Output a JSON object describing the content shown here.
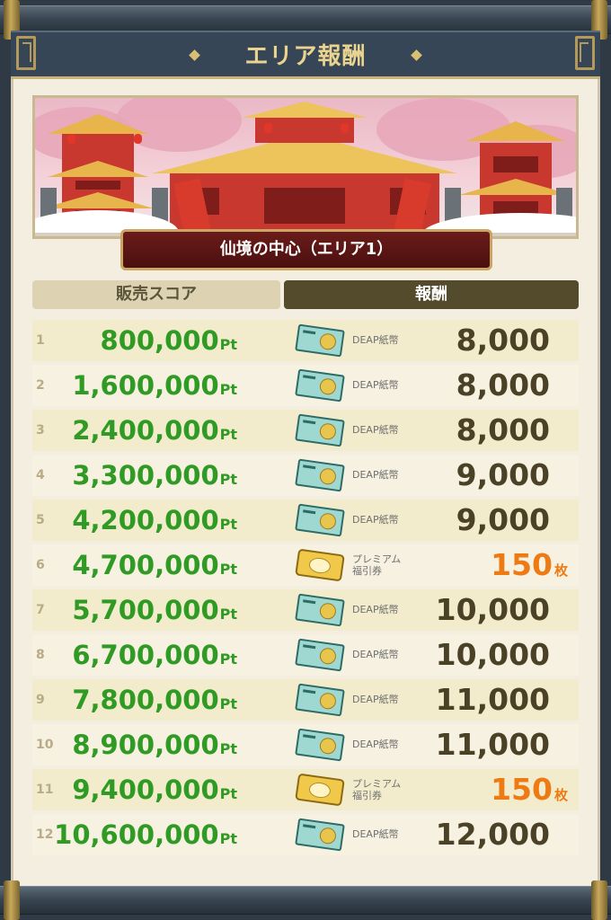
{
  "title": "エリア報酬",
  "area_name": "仙境の中心（エリア1）",
  "columns": {
    "score": "販売スコア",
    "reward": "報酬"
  },
  "score_unit": "Pt",
  "rows": [
    {
      "rank": "1",
      "score": "800,000",
      "item": "DEAP紙幣",
      "amount": "8,000",
      "unit": "",
      "ticket": "green"
    },
    {
      "rank": "2",
      "score": "1,600,000",
      "item": "DEAP紙幣",
      "amount": "8,000",
      "unit": "",
      "ticket": "green"
    },
    {
      "rank": "3",
      "score": "2,400,000",
      "item": "DEAP紙幣",
      "amount": "8,000",
      "unit": "",
      "ticket": "green"
    },
    {
      "rank": "4",
      "score": "3,300,000",
      "item": "DEAP紙幣",
      "amount": "9,000",
      "unit": "",
      "ticket": "green"
    },
    {
      "rank": "5",
      "score": "4,200,000",
      "item": "DEAP紙幣",
      "amount": "9,000",
      "unit": "",
      "ticket": "green"
    },
    {
      "rank": "6",
      "score": "4,700,000",
      "item": "プレミアム福引券",
      "amount": "150",
      "unit": "枚",
      "ticket": "gold"
    },
    {
      "rank": "7",
      "score": "5,700,000",
      "item": "DEAP紙幣",
      "amount": "10,000",
      "unit": "",
      "ticket": "green"
    },
    {
      "rank": "8",
      "score": "6,700,000",
      "item": "DEAP紙幣",
      "amount": "10,000",
      "unit": "",
      "ticket": "green"
    },
    {
      "rank": "9",
      "score": "7,800,000",
      "item": "DEAP紙幣",
      "amount": "11,000",
      "unit": "",
      "ticket": "green"
    },
    {
      "rank": "10",
      "score": "8,900,000",
      "item": "DEAP紙幣",
      "amount": "11,000",
      "unit": "",
      "ticket": "green"
    },
    {
      "rank": "11",
      "score": "9,400,000",
      "item": "プレミアム福引券",
      "amount": "150",
      "unit": "枚",
      "ticket": "gold"
    },
    {
      "rank": "12",
      "score": "10,600,000",
      "item": "DEAP紙幣",
      "amount": "12,000",
      "unit": "",
      "ticket": "green"
    }
  ],
  "colors": {
    "score_green": "#2f9a24",
    "premium_orange": "#ee7a13",
    "amount_dark": "#4a4126"
  }
}
